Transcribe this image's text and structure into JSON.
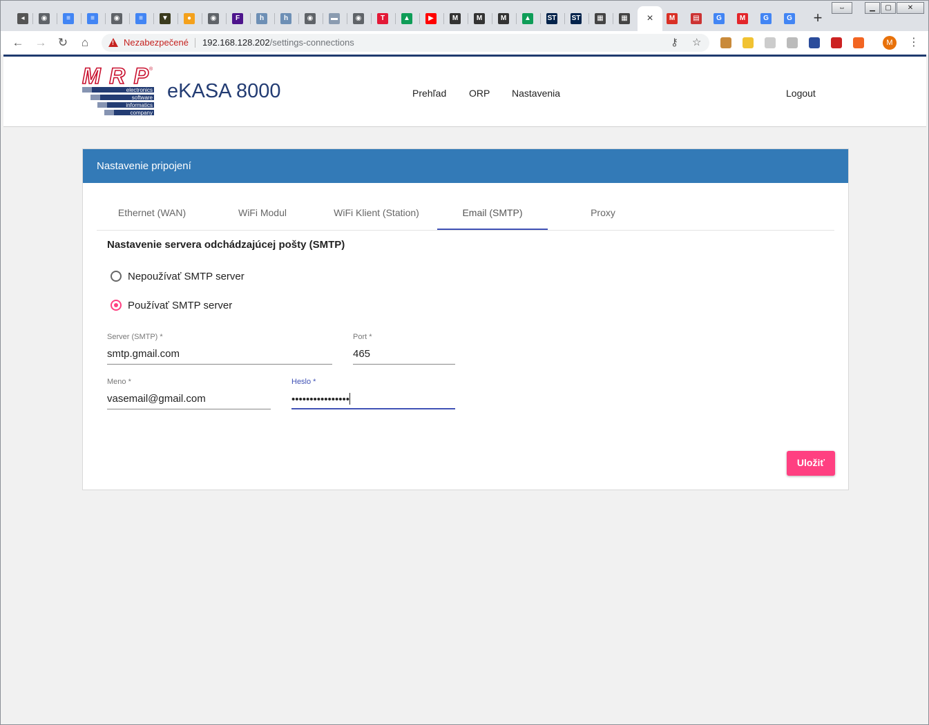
{
  "browser": {
    "active_tab_close": "×",
    "new_tab": "+",
    "security_label": "Nezabezpečené",
    "url_host": "192.168.128.202",
    "url_path": "/settings-connections",
    "profile_initial": "M",
    "tab_favicons": [
      {
        "icon": "speaker-icon",
        "color": "#555555",
        "glyph": "◂"
      },
      {
        "icon": "globe-icon",
        "color": "#5f6368",
        "glyph": "◉"
      },
      {
        "icon": "docs-icon",
        "color": "#4285f4",
        "glyph": "≡"
      },
      {
        "icon": "docs-icon",
        "color": "#4285f4",
        "glyph": "≡"
      },
      {
        "icon": "globe-icon",
        "color": "#5f6368",
        "glyph": "◉"
      },
      {
        "icon": "docs-icon",
        "color": "#4285f4",
        "glyph": "≡"
      },
      {
        "icon": "shield-crest-icon",
        "color": "#3b3b1e",
        "glyph": "▼"
      },
      {
        "icon": "orange-circle-icon",
        "color": "#f4a11c",
        "glyph": "●"
      },
      {
        "icon": "globe-icon",
        "color": "#5f6368",
        "glyph": "◉"
      },
      {
        "icon": "fedex-icon",
        "color": "#4d148c",
        "glyph": "F"
      },
      {
        "icon": "h-icon",
        "color": "#6d8fb5",
        "glyph": "h"
      },
      {
        "icon": "h-icon",
        "color": "#6d8fb5",
        "glyph": "h"
      },
      {
        "icon": "globe-icon",
        "color": "#5f6368",
        "glyph": "◉"
      },
      {
        "icon": "flag-icon",
        "color": "#8a9bb0",
        "glyph": "▬"
      },
      {
        "icon": "globe-icon",
        "color": "#5f6368",
        "glyph": "◉"
      },
      {
        "icon": "t-icon",
        "color": "#e31937",
        "glyph": "T"
      },
      {
        "icon": "drive-icon",
        "color": "#0f9d58",
        "glyph": "▲"
      },
      {
        "icon": "youtube-icon",
        "color": "#ff0000",
        "glyph": "▶"
      },
      {
        "icon": "m-icon",
        "color": "#333333",
        "glyph": "M"
      },
      {
        "icon": "m-icon",
        "color": "#333333",
        "glyph": "M"
      },
      {
        "icon": "m-icon",
        "color": "#333333",
        "glyph": "M"
      },
      {
        "icon": "drive-icon",
        "color": "#0f9d58",
        "glyph": "▲"
      },
      {
        "icon": "st-icon",
        "color": "#03234b",
        "glyph": "ST"
      },
      {
        "icon": "st-icon",
        "color": "#03234b",
        "glyph": "ST"
      },
      {
        "icon": "qr-icon",
        "color": "#444444",
        "glyph": "▦"
      },
      {
        "icon": "qr-icon",
        "color": "#444444",
        "glyph": "▦"
      }
    ],
    "tab_favicons_right": [
      {
        "icon": "gmail-icon",
        "color": "#d93025",
        "glyph": "M"
      },
      {
        "icon": "newspaper-icon",
        "color": "#cc3333",
        "glyph": "▤"
      },
      {
        "icon": "google-icon",
        "color": "#4285f4",
        "glyph": "G"
      },
      {
        "icon": "microchip-icon",
        "color": "#e3262b",
        "glyph": "M"
      },
      {
        "icon": "google-icon",
        "color": "#4285f4",
        "glyph": "G"
      },
      {
        "icon": "google-icon",
        "color": "#4285f4",
        "glyph": "G"
      }
    ],
    "extensions": [
      {
        "icon": "cookie-icon",
        "color": "#c98a3a"
      },
      {
        "icon": "moon-icon",
        "color": "#f1c232"
      },
      {
        "icon": "cast-icon",
        "color": "#cccccc"
      },
      {
        "icon": "calendar-icon",
        "color": "#bbbbbb"
      },
      {
        "icon": "flag-icon",
        "color": "#2b4c9b"
      },
      {
        "icon": "badge-icon",
        "color": "#cc2222"
      },
      {
        "icon": "lifebuoy-icon",
        "color": "#f26522"
      }
    ]
  },
  "app": {
    "title": "eKASA 8000",
    "logo": {
      "wordmark": "MRP",
      "lines": [
        "electronics",
        "software",
        "informatics",
        "company"
      ]
    },
    "nav": {
      "overview": "Prehľad",
      "orp": "ORP",
      "settings": "Nastavenia",
      "logout": "Logout"
    }
  },
  "card": {
    "title": "Nastavenie pripojení",
    "tabs": [
      "Ethernet (WAN)",
      "WiFi Modul",
      "WiFi Klient (Station)",
      "Email (SMTP)",
      "Proxy"
    ],
    "active_tab": "Email (SMTP)",
    "section_title": "Nastavenie servera odchádzajúcej pošty (SMTP)",
    "radio_no": "Nepoužívať SMTP server",
    "radio_yes": "Používať SMTP server",
    "selected": "yes",
    "fields": {
      "server": {
        "label": "Server (SMTP) *",
        "value": "smtp.gmail.com"
      },
      "port": {
        "label": "Port *",
        "value": "465"
      },
      "username": {
        "label": "Meno *",
        "value": "vasemail@gmail.com"
      },
      "password": {
        "label": "Heslo *",
        "value": "••••••••••••••••"
      }
    },
    "save_label": "Uložiť"
  },
  "colors": {
    "header_blue": "#337ab7",
    "accent_pink": "#ff4081",
    "focus_indigo": "#3f51b5",
    "brand_navy": "#233c73"
  }
}
